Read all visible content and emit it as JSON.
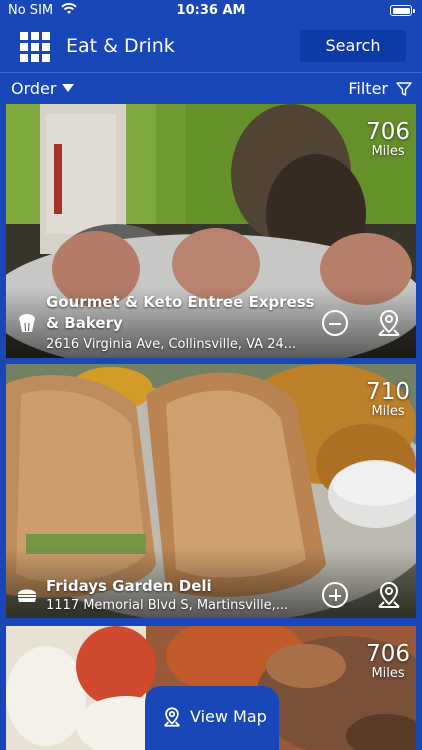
{
  "status_bar": {
    "carrier": "No SIM",
    "time": "10:36 AM"
  },
  "header": {
    "title": "Eat & Drink",
    "search_label": "Search",
    "menu_icon": "grid-menu-icon"
  },
  "toolbar": {
    "order_label": "Order",
    "filter_label": "Filter"
  },
  "listings": [
    {
      "distance": "706",
      "distance_unit": "Miles",
      "name_line1": "Gourmet & Keto Entree Express",
      "name_line2": "& Bakery",
      "address": "2616 Virginia Ave, Collinsville, VA 24...",
      "category_icon": "bakery-icon",
      "action": "remove"
    },
    {
      "distance": "710",
      "distance_unit": "Miles",
      "name_line1": "Fridays Garden Deli",
      "address": "1117 Memorial Blvd S, Martinsville,...",
      "category_icon": "sandwich-icon",
      "action": "add"
    },
    {
      "distance": "706",
      "distance_unit": "Miles"
    }
  ],
  "view_map": {
    "label": "View Map"
  },
  "colors": {
    "brand_blue": "#1a47b8",
    "search_button": "#0e3aa8"
  }
}
